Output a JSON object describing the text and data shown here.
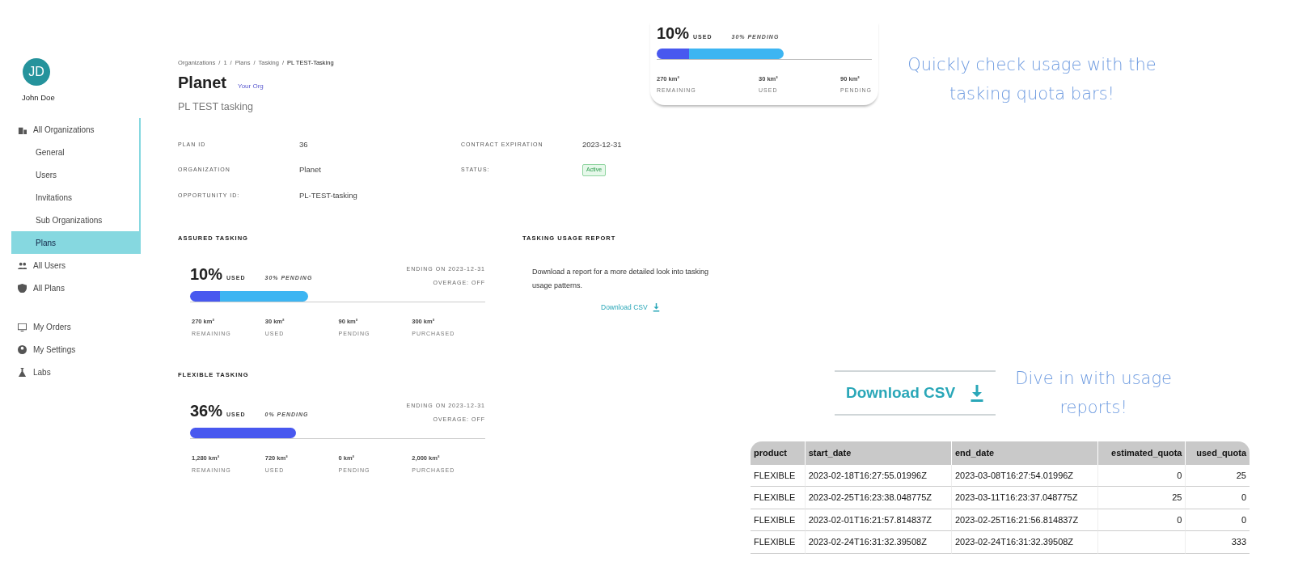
{
  "user": {
    "initials": "JD",
    "name": "John Doe"
  },
  "sidebar": {
    "items": [
      {
        "label": "All Organizations",
        "selected": false,
        "children": [
          {
            "label": "General",
            "selected": false
          },
          {
            "label": "Users",
            "selected": false
          },
          {
            "label": "Invitations",
            "selected": false
          },
          {
            "label": "Sub Organizations",
            "selected": false
          },
          {
            "label": "Plans",
            "selected": true
          }
        ]
      },
      {
        "label": "All Users",
        "selected": false
      },
      {
        "label": "All Plans",
        "selected": false
      },
      {
        "label": "My Orders",
        "selected": false
      },
      {
        "label": "My Settings",
        "selected": false
      },
      {
        "label": "Labs",
        "selected": false
      }
    ]
  },
  "breadcrumb": [
    "Organizations",
    "/",
    "1",
    "/",
    "Plans",
    "/",
    "Tasking",
    "/",
    "PL TEST-Tasking"
  ],
  "title": "Planet",
  "org_tag": "Your Org",
  "subtitle": "PL TEST tasking",
  "details": [
    {
      "label": "PLAN ID",
      "value": "36",
      "kind": "text"
    },
    {
      "label": "CONTRACT EXPIRATION",
      "value": "2023-12-31",
      "kind": "text"
    },
    {
      "label": "ORGANIZATION",
      "value": "Planet",
      "kind": "text"
    },
    {
      "label": "STATUS:",
      "value": "Active",
      "kind": "badge"
    },
    {
      "label": "OPPORTUNITY ID:",
      "value": "PL-TEST-tasking",
      "kind": "text"
    }
  ],
  "quotas": [
    {
      "heading": "ASSURED TASKING",
      "percent": "10%",
      "used_label": "USED",
      "pending": "30% PENDING",
      "ending": "ENDING ON 2023-12-31",
      "overage": "OVERAGE: OFF",
      "segments": [
        {
          "kind": "used",
          "level": 0.1
        },
        {
          "kind": "pending",
          "level": 0.3
        }
      ],
      "stats": [
        {
          "value": "270 km²",
          "label": "REMAINING"
        },
        {
          "value": "30 km²",
          "label": "USED"
        },
        {
          "value": "90 km²",
          "label": "PENDING"
        },
        {
          "value": "300 km²",
          "label": "PURCHASED"
        }
      ]
    },
    {
      "heading": "FLEXIBLE TASKING",
      "percent": "36%",
      "used_label": "USED",
      "pending": "0% PENDING",
      "ending": "ENDING ON 2023-12-31",
      "overage": "OVERAGE: OFF",
      "segments": [
        {
          "kind": "used",
          "level": 0.36
        }
      ],
      "stats": [
        {
          "value": "1,280 km²",
          "label": "REMAINING"
        },
        {
          "value": "720 km²",
          "label": "USED"
        },
        {
          "value": "0 km²",
          "label": "PENDING"
        },
        {
          "value": "2,000 km²",
          "label": "PURCHASED"
        }
      ]
    }
  ],
  "report": {
    "heading": "TASKING USAGE REPORT",
    "text": "Download a report for a more detailed look into tasking usage patterns.",
    "link": "Download CSV"
  },
  "zoom_card": {
    "percent": "10%",
    "used_label": "USED",
    "pending": "30% PENDING",
    "stats": [
      {
        "value": "270 km²",
        "label": "REMAINING"
      },
      {
        "value": "30 km²",
        "label": "USED"
      },
      {
        "value": "90 km²",
        "label": "PENDING"
      }
    ]
  },
  "caption_top": "Quickly check usage with the tasking quota bars!",
  "download_button": "Download CSV",
  "caption_bottom": "Dive in with usage reports!",
  "table": {
    "columns": [
      "product",
      "start_date",
      "end_date",
      "estimated_quota",
      "used_quota"
    ],
    "rows": [
      [
        "FLEXIBLE",
        "2023-02-18T16:27:55.01996Z",
        "2023-03-08T16:27:54.01996Z",
        "0",
        "25"
      ],
      [
        "FLEXIBLE",
        "2023-02-25T16:23:38.048775Z",
        "2023-03-11T16:23:37.048775Z",
        "25",
        "0"
      ],
      [
        "FLEXIBLE",
        "2023-02-01T16:21:57.814837Z",
        "2023-02-25T16:21:56.814837Z",
        "0",
        "0"
      ],
      [
        "FLEXIBLE",
        "2023-02-24T16:31:32.39508Z",
        "2023-02-24T16:31:32.39508Z",
        "",
        "333"
      ]
    ]
  }
}
